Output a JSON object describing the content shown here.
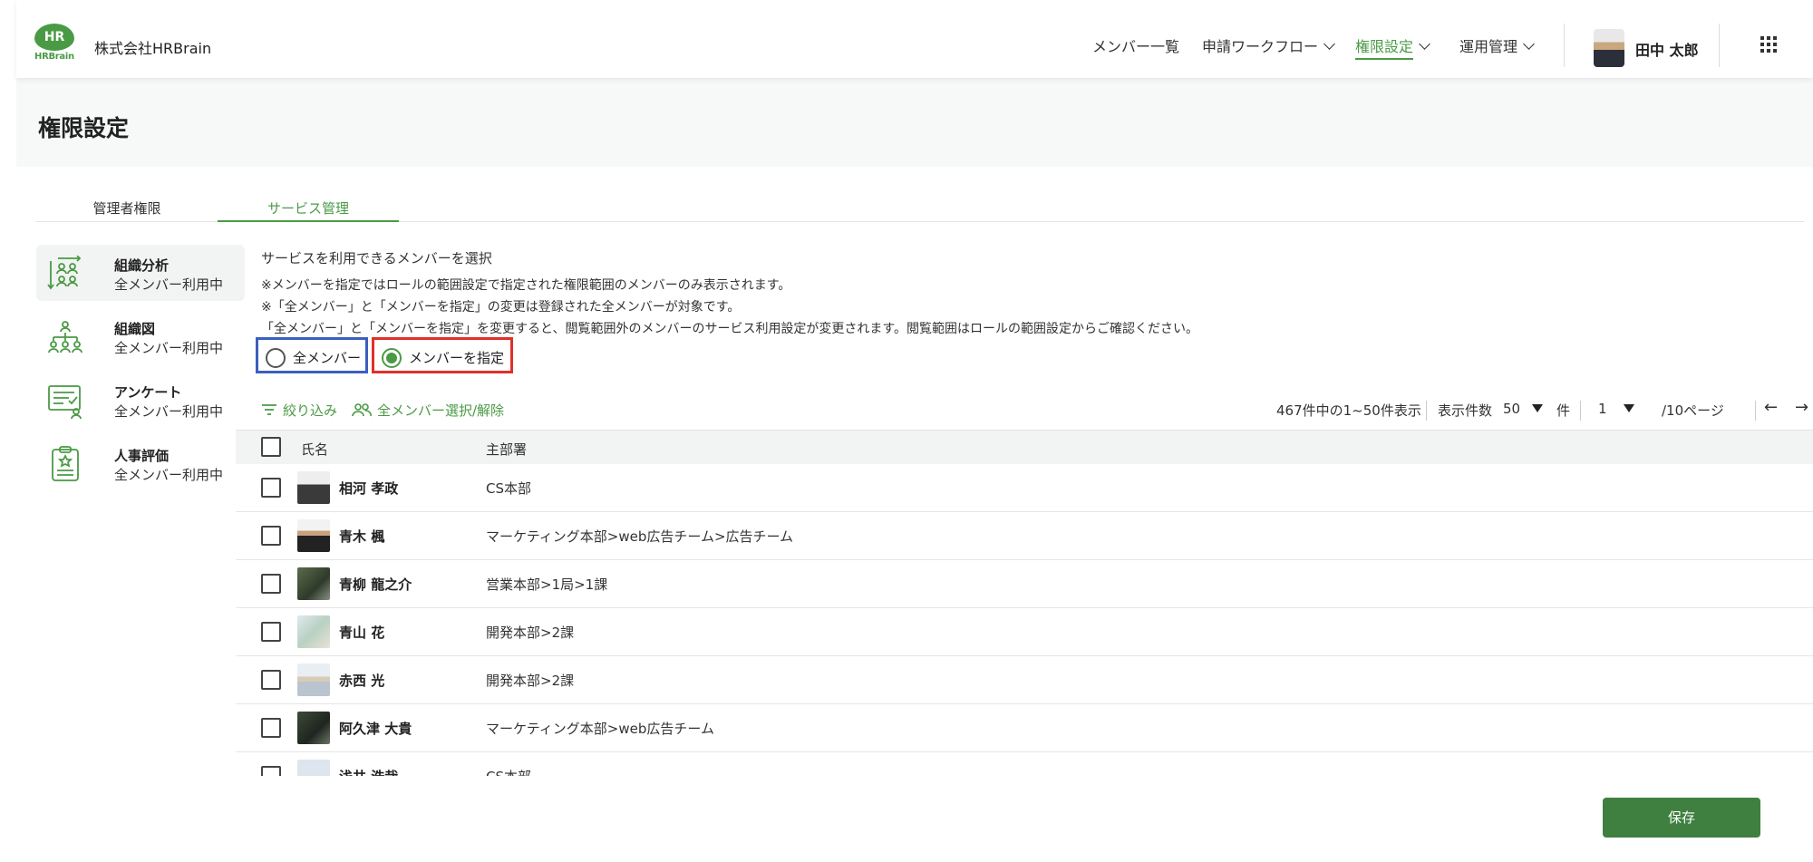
{
  "header": {
    "logo_text": "HR",
    "logo_sub": "HRBrain",
    "company": "株式会社HRBrain",
    "nav": [
      {
        "label": "メンバー一覧"
      },
      {
        "label": "申請ワークフロー"
      },
      {
        "label": "権限設定"
      },
      {
        "label": "運用管理"
      }
    ],
    "user_name": "田中 太郎"
  },
  "page_title": "権限設定",
  "tabs": [
    {
      "label": "管理者権限"
    },
    {
      "label": "サービス管理"
    }
  ],
  "services": [
    {
      "name": "組織分析",
      "status": "全メンバー利用中",
      "icon": "org-analysis-icon"
    },
    {
      "name": "組織図",
      "status": "全メンバー利用中",
      "icon": "org-chart-icon"
    },
    {
      "name": "アンケート",
      "status": "全メンバー利用中",
      "icon": "survey-icon"
    },
    {
      "name": "人事評価",
      "status": "全メンバー利用中",
      "icon": "evaluation-icon"
    }
  ],
  "content": {
    "heading": "サービスを利用できるメンバーを選択",
    "note1": "※メンバーを指定ではロールの範囲設定で指定された権限範囲のメンバーのみ表示されます。",
    "note2": "※「全メンバー」と「メンバーを指定」の変更は登録された全メンバーが対象です。",
    "note3": "「全メンバー」と「メンバーを指定」を変更すると、閲覧範囲外のメンバーのサービス利用設定が変更されます。閲覧範囲はロールの範囲設定からご確認ください。",
    "radio_all": "全メンバー",
    "radio_specify": "メンバーを指定",
    "selected": "メンバーを指定"
  },
  "toolbar": {
    "filter": "絞り込み",
    "select_all": "全メンバー選択/解除",
    "count": "467件中の1~50件表示",
    "per_page_label": "表示件数",
    "per_page": "50",
    "per_page_unit": "件",
    "page": "1",
    "total_pages": "/10ページ"
  },
  "table": {
    "col_name": "氏名",
    "col_dept": "主部署",
    "rows": [
      {
        "name": "相河 孝政",
        "dept": "CS本部"
      },
      {
        "name": "青木 楓",
        "dept": "マーケティング本部>web広告チーム>広告チーム"
      },
      {
        "name": "青柳 龍之介",
        "dept": "営業本部>1局>1課"
      },
      {
        "name": "青山 花",
        "dept": "開発本部>2課"
      },
      {
        "name": "赤西 光",
        "dept": "開発本部>2課"
      },
      {
        "name": "阿久津 大貴",
        "dept": "マーケティング本部>web広告チーム"
      },
      {
        "name": "浅井 浩哉",
        "dept": "CS本部"
      }
    ]
  },
  "save_label": "保存",
  "colors": {
    "accent": "#4a9a45",
    "save": "#3f7f3f",
    "blue_frame": "#3a5fbf",
    "red_frame": "#e0302a"
  }
}
